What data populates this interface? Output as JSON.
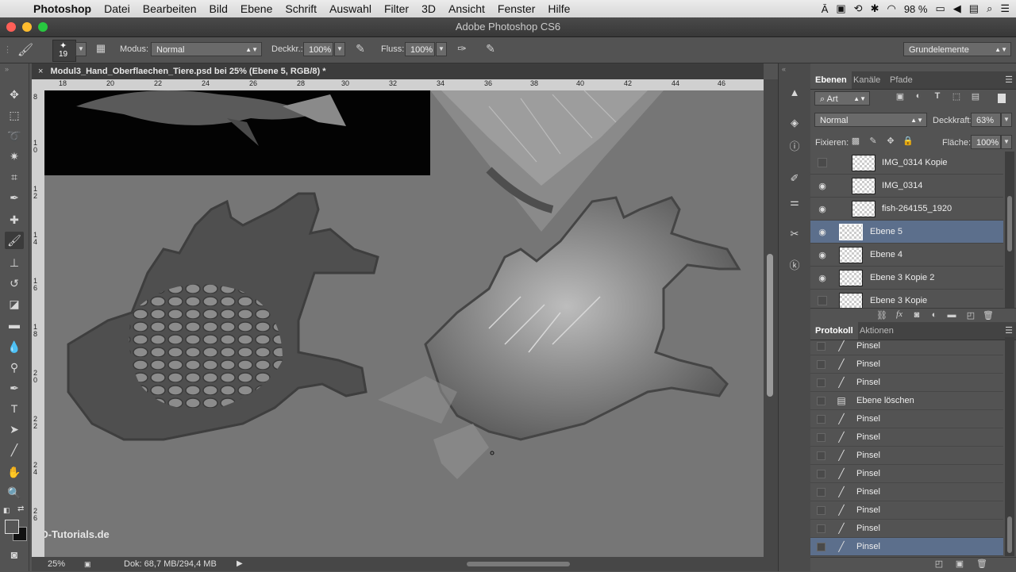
{
  "menubar": {
    "app": "Photoshop",
    "items": [
      "Datei",
      "Bearbeiten",
      "Bild",
      "Ebene",
      "Schrift",
      "Auswahl",
      "Filter",
      "3D",
      "Ansicht",
      "Fenster",
      "Hilfe"
    ],
    "battery": "98 %"
  },
  "window": {
    "title": "Adobe Photoshop CS6"
  },
  "options": {
    "brush_size": "19",
    "mode_label": "Modus:",
    "mode_value": "Normal",
    "opacity_label": "Deckkr.:",
    "opacity_value": "100%",
    "flow_label": "Fluss:",
    "flow_value": "100%",
    "workspace": "Grundelemente"
  },
  "document": {
    "tab_title": "Modul3_Hand_Oberflaechen_Tiere.psd bei 25% (Ebene 5, RGB/8) *",
    "ruler_top": [
      "18",
      "20",
      "22",
      "24",
      "26",
      "28",
      "30",
      "32",
      "34",
      "36",
      "38",
      "40",
      "42",
      "44",
      "46"
    ],
    "ruler_left": [
      "8",
      "1\n0",
      "1\n2",
      "1\n4",
      "1\n6",
      "1\n8",
      "2\n0",
      "2\n2",
      "2\n4",
      "2\n6"
    ],
    "zoom": "25%",
    "doc_info": "Dok: 68,7 MB/294,4 MB",
    "watermark": "PSD-Tutorials.de"
  },
  "layers_panel": {
    "tabs": [
      "Ebenen",
      "Kanäle",
      "Pfade"
    ],
    "filter_kind": "Art",
    "blend_mode": "Normal",
    "opacity_label": "Deckkraft:",
    "opacity_value": "63%",
    "lock_label": "Fixieren:",
    "fill_label": "Fläche:",
    "fill_value": "100%",
    "layers": [
      {
        "name": "IMG_0314 Kopie",
        "visible": false,
        "selected": false
      },
      {
        "name": "IMG_0314",
        "visible": true,
        "selected": false
      },
      {
        "name": "fish-264155_1920",
        "visible": true,
        "selected": false
      },
      {
        "name": "Ebene 5",
        "visible": true,
        "selected": true
      },
      {
        "name": "Ebene 4",
        "visible": true,
        "selected": false
      },
      {
        "name": "Ebene 3 Kopie 2",
        "visible": true,
        "selected": false
      },
      {
        "name": "Ebene 3 Kopie",
        "visible": false,
        "selected": false
      }
    ]
  },
  "history_panel": {
    "tabs": [
      "Protokoll",
      "Aktionen"
    ],
    "items": [
      {
        "name": "Pinsel",
        "icon": "brush-icon"
      },
      {
        "name": "Pinsel",
        "icon": "brush-icon"
      },
      {
        "name": "Pinsel",
        "icon": "brush-icon"
      },
      {
        "name": "Ebene löschen",
        "icon": "document-icon"
      },
      {
        "name": "Pinsel",
        "icon": "brush-icon"
      },
      {
        "name": "Pinsel",
        "icon": "brush-icon"
      },
      {
        "name": "Pinsel",
        "icon": "brush-icon"
      },
      {
        "name": "Pinsel",
        "icon": "brush-icon"
      },
      {
        "name": "Pinsel",
        "icon": "brush-icon"
      },
      {
        "name": "Pinsel",
        "icon": "brush-icon"
      },
      {
        "name": "Pinsel",
        "icon": "brush-icon"
      },
      {
        "name": "Pinsel",
        "icon": "brush-icon"
      }
    ],
    "selected_index": 11
  },
  "colors": {
    "selection": "#5c6f8c",
    "panel_bg": "#535353",
    "canvas_bg": "#767676"
  }
}
